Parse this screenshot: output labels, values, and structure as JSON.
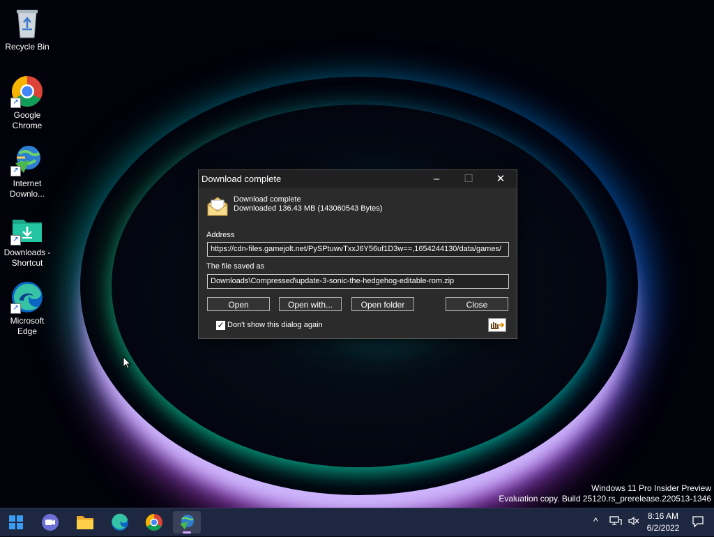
{
  "desktop": {
    "icons": [
      {
        "label": "Recycle Bin"
      },
      {
        "label": "Google Chrome"
      },
      {
        "label": "Internet Downlo..."
      },
      {
        "label": "Downloads - Shortcut"
      },
      {
        "label": "Microsoft Edge"
      }
    ]
  },
  "dialog": {
    "title": "Download complete",
    "status_heading": "Download complete",
    "status_detail": "Downloaded 136.43  MB (143060543 Bytes)",
    "address_label": "Address",
    "address_value": "https://cdn-files.gamejolt.net/PySPtuwvTxxJ6Y56uf1D3w==,1654244130/data/games/",
    "saved_label": "The file saved as",
    "saved_value": "Downloads\\Compressed\\update-3-sonic-the-hedgehog-editable-rom.zip",
    "buttons": {
      "open": "Open",
      "open_with": "Open with...",
      "open_folder": "Open folder",
      "close": "Close"
    },
    "dont_show_label": "Don't show this dialog again",
    "dont_show_checked": true
  },
  "watermark": {
    "line1": "Windows 11 Pro Insider Preview",
    "line2": "Evaluation copy. Build 25120.rs_prerelease.220513-1346"
  },
  "taskbar": {
    "time": "8:16 AM",
    "date": "6/2/2022"
  },
  "colors": {
    "accent": "#d6a7ff",
    "dialog_bg": "#2b2b2b",
    "taskbar_bg": "#1d2740"
  }
}
